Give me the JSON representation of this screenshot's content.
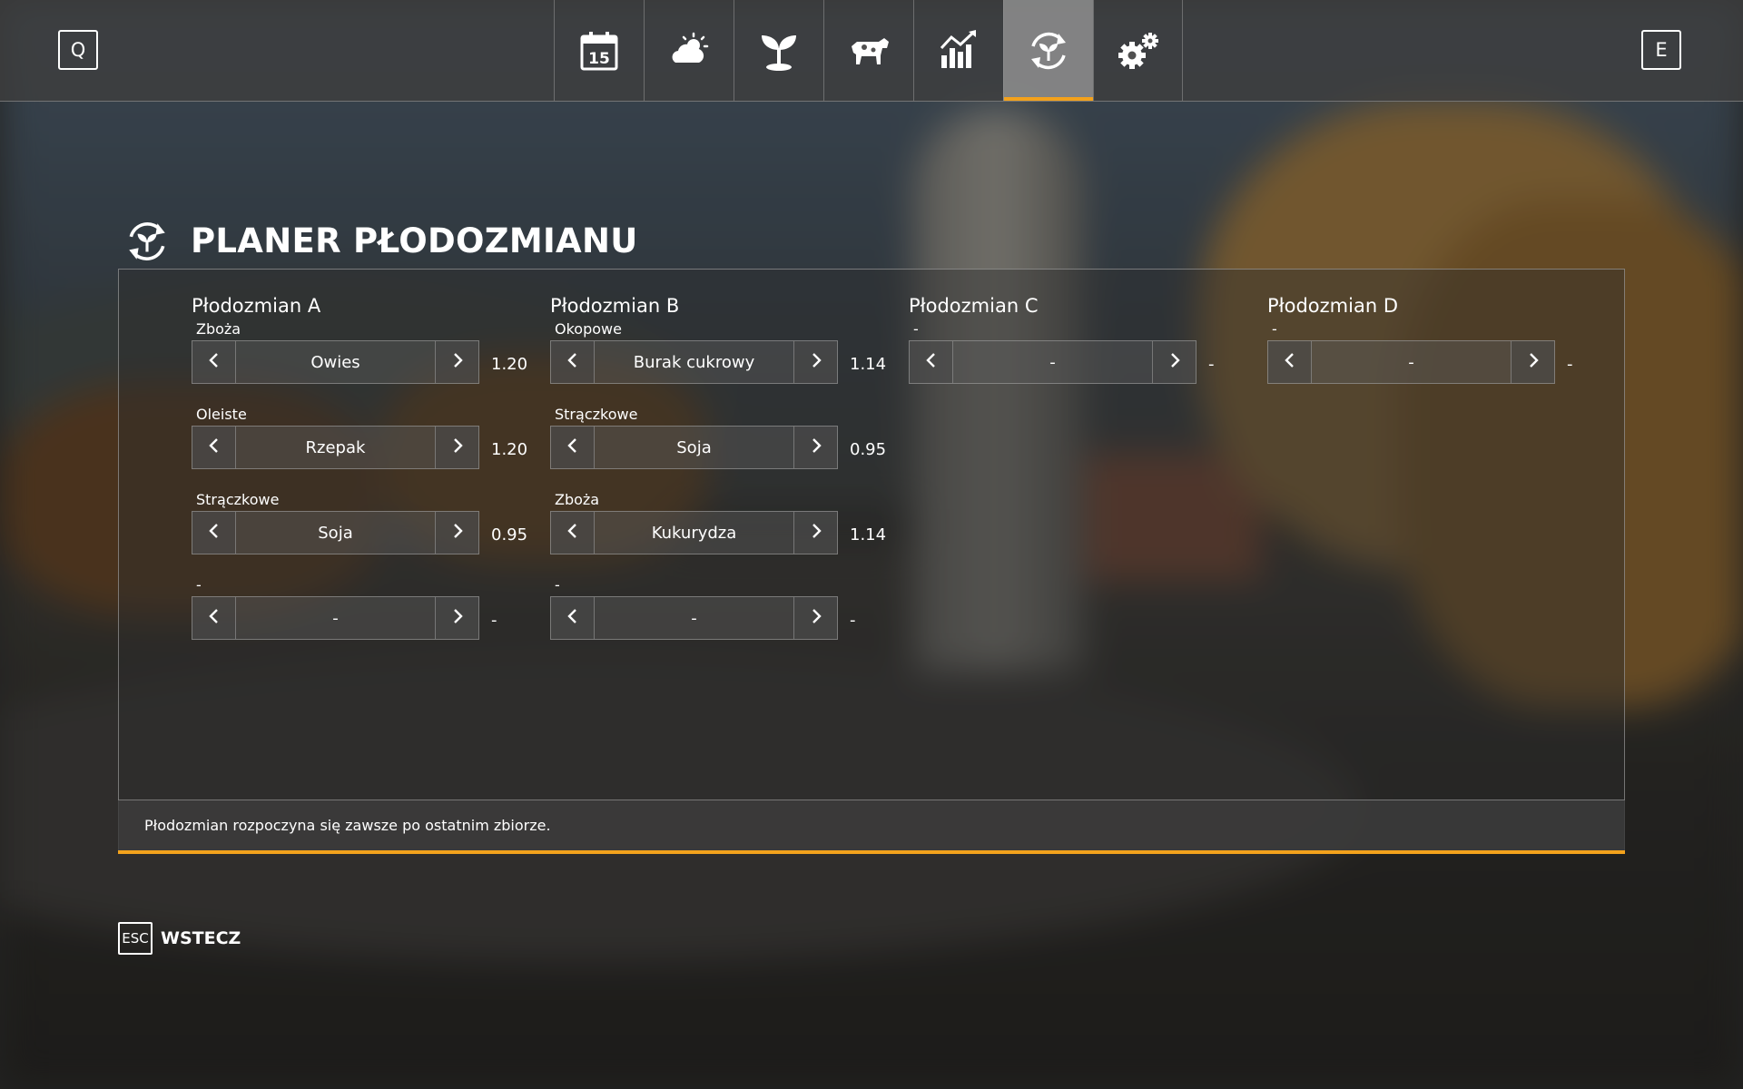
{
  "keys": {
    "prev": "Q",
    "next": "E",
    "back_key": "ESC"
  },
  "tabs": [
    {
      "name": "calendar",
      "icon": "calendar-icon",
      "day": "15",
      "active": false
    },
    {
      "name": "weather",
      "icon": "weather-icon",
      "active": false
    },
    {
      "name": "crops",
      "icon": "sprout-icon",
      "active": false
    },
    {
      "name": "animals",
      "icon": "cow-icon",
      "active": false
    },
    {
      "name": "statistics",
      "icon": "chart-icon",
      "active": false
    },
    {
      "name": "crop-rotation",
      "icon": "crop-rotation-icon",
      "active": true
    },
    {
      "name": "settings",
      "icon": "gears-icon",
      "active": false
    }
  ],
  "accent_color": "#f3a21c",
  "page": {
    "title": "PLANER PŁODOZMIANU",
    "icon": "crop-rotation-icon"
  },
  "rotations": [
    {
      "title": "Płodozmian A",
      "slots": [
        {
          "category": "Zboża",
          "crop": "Owies",
          "multiplier": "1.20"
        },
        {
          "category": "Oleiste",
          "crop": "Rzepak",
          "multiplier": "1.20"
        },
        {
          "category": "Strączkowe",
          "crop": "Soja",
          "multiplier": "0.95"
        },
        {
          "category": "-",
          "crop": "-",
          "multiplier": "-"
        }
      ]
    },
    {
      "title": "Płodozmian B",
      "slots": [
        {
          "category": "Okopowe",
          "crop": "Burak cukrowy",
          "multiplier": "1.14"
        },
        {
          "category": "Strączkowe",
          "crop": "Soja",
          "multiplier": "0.95"
        },
        {
          "category": "Zboża",
          "crop": "Kukurydza",
          "multiplier": "1.14"
        },
        {
          "category": "-",
          "crop": "-",
          "multiplier": "-"
        }
      ]
    },
    {
      "title": "Płodozmian C",
      "slots": [
        {
          "category": "-",
          "crop": "-",
          "multiplier": "-"
        }
      ]
    },
    {
      "title": "Płodozmian D",
      "slots": [
        {
          "category": "-",
          "crop": "-",
          "multiplier": "-"
        }
      ]
    }
  ],
  "footer": {
    "note": "Płodozmian rozpoczyna się zawsze po ostatnim zbiorze."
  },
  "back": {
    "label": "WSTECZ"
  }
}
